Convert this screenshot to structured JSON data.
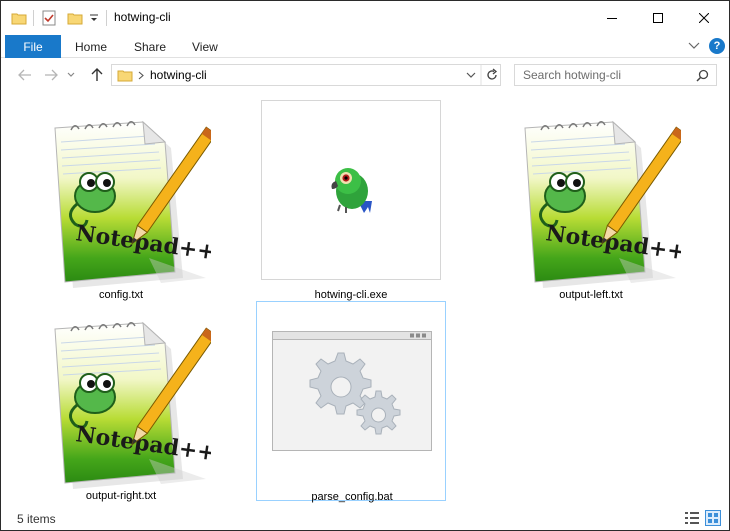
{
  "window": {
    "title": "hotwing-cli"
  },
  "ribbon": {
    "tabs": [
      {
        "label": "File"
      },
      {
        "label": "Home"
      },
      {
        "label": "Share"
      },
      {
        "label": "View"
      }
    ],
    "help_label": "?"
  },
  "address_bar": {
    "path": "hotwing-cli"
  },
  "search": {
    "placeholder": "Search hotwing-cli"
  },
  "files": [
    {
      "name": "config.txt",
      "icon": "notepad-plus-plus-icon"
    },
    {
      "name": "hotwing-cli.exe",
      "icon": "parrot-app-icon"
    },
    {
      "name": "output-left.txt",
      "icon": "notepad-plus-plus-icon"
    },
    {
      "name": "output-right.txt",
      "icon": "notepad-plus-plus-icon"
    },
    {
      "name": "parse_config.bat",
      "icon": "batch-gears-icon"
    }
  ],
  "status_bar": {
    "item_count": "5 items"
  },
  "colors": {
    "accent": "#1979ca",
    "selection_border": "#99d1ff",
    "folder": "#f8d775"
  }
}
